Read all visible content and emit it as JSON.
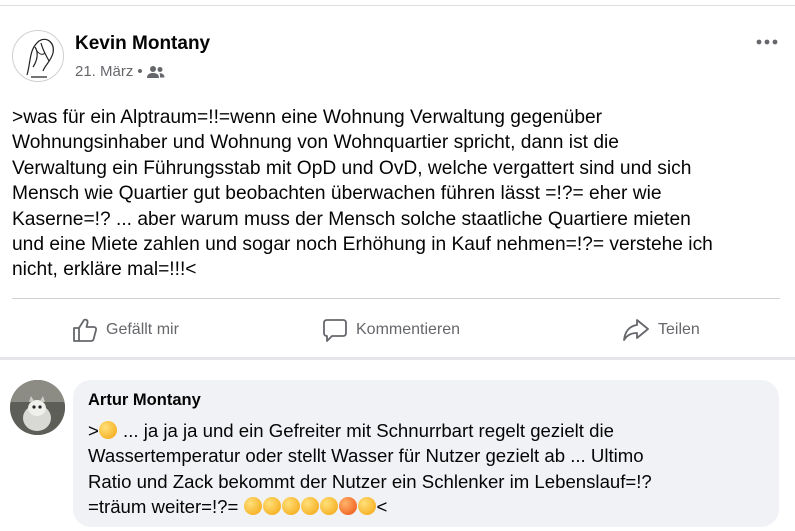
{
  "post": {
    "author": "Kevin Montany",
    "date": "21. März",
    "separator": "•",
    "audience_icon": "friends-icon",
    "more_icon": "more-horizontal-icon",
    "text": ">was für ein Alptraum=!!=wenn eine Wohnung Verwaltung gegenüber\nWohnungsinhaber und Wohnung von Wohnquartier spricht, dann ist die\nVerwaltung ein Führungsstab mit OpD und OvD, welche vergattert sind und sich\nMensch wie Quartier gut beobachten überwachen führen lässt =!?= eher wie\nKaserne=!? ... aber warum muss der Mensch solche staatliche  Quartiere mieten\nund eine Miete zahlen und sogar noch Erhöhung in Kauf nehmen=!?= verstehe ich\nnicht, erkläre mal=!!!<"
  },
  "actions": {
    "like": "Gefällt mir",
    "comment": "Kommentieren",
    "share": "Teilen"
  },
  "comment": {
    "author": "Artur Montany",
    "prefix": ">",
    "text_line1": " ... ja ja ja und ein Gefreiter mit Schnurrbart regelt gezielt die",
    "text_rest": "Wassertemperatur oder stellt Wasser für Nutzer gezielt ab ... Ultimo\nRatio und Zack bekommt der Nutzer ein Schlenker im Lebenslauf=!?\n=träum weiter=!?=  ",
    "suffix": "<",
    "emoji_count_end": 7
  }
}
